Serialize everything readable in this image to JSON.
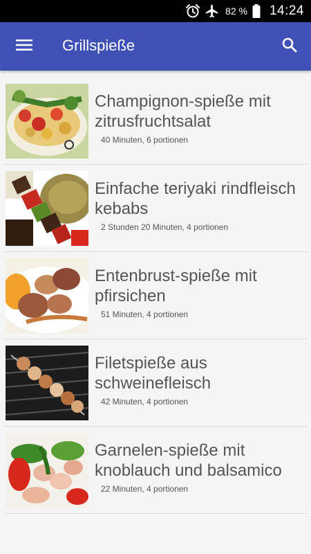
{
  "status_bar": {
    "battery": "82 %",
    "time": "14:24",
    "icons": [
      "alarm-icon",
      "airplane-mode-icon",
      "battery-icon"
    ]
  },
  "app_bar": {
    "title": "Grillspieße",
    "menu_icon": "hamburger-menu-icon",
    "search_icon": "search-icon",
    "color": "#3f51b5"
  },
  "recipes": [
    {
      "title": "Champignon-spieße mit zitrusfruchtsalat",
      "meta": "40 Minuten, 6 portionen"
    },
    {
      "title": "Einfache teriyaki rindfleisch kebabs",
      "meta": "2 Stunden 20 Minuten, 4 portionen"
    },
    {
      "title": "Entenbrust-spieße mit pfirsichen",
      "meta": "51 Minuten, 4 portionen"
    },
    {
      "title": "Filetspieße aus schweinefleisch",
      "meta": "42 Minuten, 4 portionen"
    },
    {
      "title": "Garnelen-spieße mit knoblauch und balsamico",
      "meta": "22 Minuten, 4 portionen"
    }
  ]
}
